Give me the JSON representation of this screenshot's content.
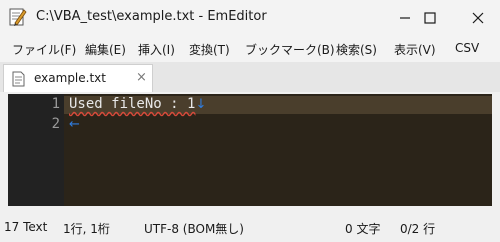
{
  "window": {
    "title": "C:\\VBA_test\\example.txt - EmEditor"
  },
  "menu": {
    "items": [
      "ファイル(F)",
      "編集(E)",
      "挿入(I)",
      "変換(T)",
      "ブックマーク(B)",
      "検索(S)",
      "表示(V)",
      "CSV"
    ]
  },
  "tabs": [
    {
      "label": "example.txt",
      "close": "×"
    }
  ],
  "editor": {
    "lines": [
      {
        "number": "1",
        "text": "Used fileNo : 1",
        "eol": "↓"
      },
      {
        "number": "2",
        "text": "",
        "eol": "←"
      }
    ]
  },
  "status": {
    "items": [
      "17 Text",
      "1行, 1桁",
      "UTF-8 (BOM無し)",
      "0 文字",
      "0/2 行"
    ]
  },
  "colors": {
    "editor_bg": "#2b2419",
    "gutter_bg": "#222222",
    "current_line": "#4a3e2c",
    "eol_mark": "#2f7de0"
  },
  "icons": [
    "app-pen-icon",
    "minimize-icon",
    "maximize-icon",
    "close-icon",
    "text-file-icon",
    "tab-close-icon"
  ]
}
